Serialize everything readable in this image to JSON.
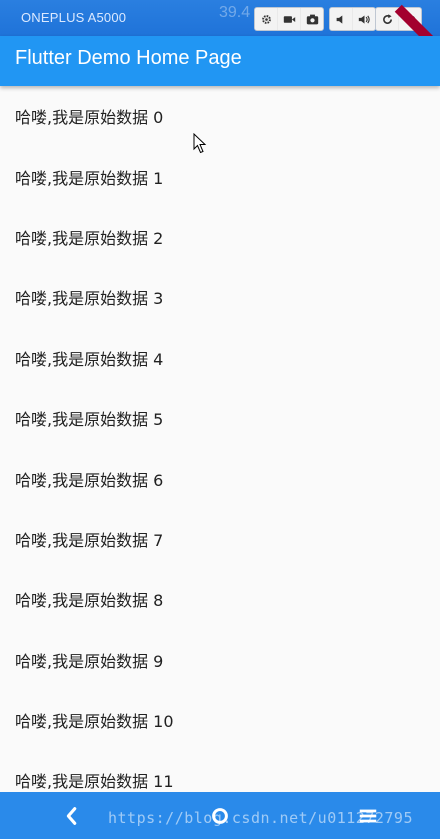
{
  "emulator": {
    "device_name": "ONEPLUS A5000",
    "status_partial": "39.4"
  },
  "app_bar": {
    "title": "Flutter Demo Home Page",
    "color": "#2196f3"
  },
  "list": {
    "items": [
      "哈喽,我是原始数据 0",
      "哈喽,我是原始数据 1",
      "哈喽,我是原始数据 2",
      "哈喽,我是原始数据 3",
      "哈喽,我是原始数据 4",
      "哈喽,我是原始数据 5",
      "哈喽,我是原始数据 6",
      "哈喽,我是原始数据 7",
      "哈喽,我是原始数据 8",
      "哈喽,我是原始数据 9",
      "哈喽,我是原始数据 10",
      "哈喽,我是原始数据 11"
    ]
  },
  "watermark": "https://blog.csdn.net/u011272795",
  "icons": {
    "nav_back": "back-icon",
    "nav_home": "home-icon",
    "nav_recents": "recents-icon"
  }
}
